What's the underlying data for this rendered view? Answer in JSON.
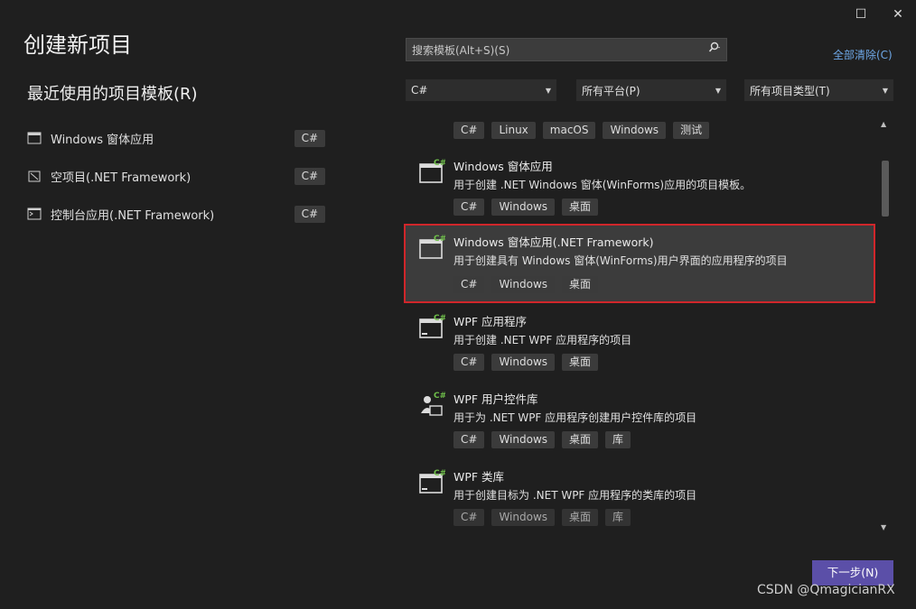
{
  "window": {
    "title": "创建新项目",
    "maximize_glyph": "☐",
    "close_glyph": "✕"
  },
  "recent": {
    "title": "最近使用的项目模板(R)",
    "items": [
      {
        "label": "Windows 窗体应用",
        "lang": "C#",
        "icon": "winforms-template-icon"
      },
      {
        "label": "空项目(.NET Framework)",
        "lang": "C#",
        "icon": "empty-project-icon"
      },
      {
        "label": "控制台应用(.NET Framework)",
        "lang": "C#",
        "icon": "console-app-icon"
      }
    ]
  },
  "search": {
    "placeholder": "搜索模板(Alt+S)(S)",
    "icon": "search-icon"
  },
  "clear_all": "全部清除(C)",
  "filters": [
    {
      "value": "C#"
    },
    {
      "value": "所有平台(P)"
    },
    {
      "value": "所有项目类型(T)"
    }
  ],
  "top_tags": [
    "C#",
    "Linux",
    "macOS",
    "Windows",
    "测试"
  ],
  "templates": [
    {
      "title": "Windows 窗体应用",
      "desc": "用于创建 .NET Windows 窗体(WinForms)应用的项目模板。",
      "tags": [
        "C#",
        "Windows",
        "桌面"
      ],
      "selected": false
    },
    {
      "title": "Windows 窗体应用(.NET Framework)",
      "desc": "用于创建具有 Windows 窗体(WinForms)用户界面的应用程序的项目",
      "tags": [
        "C#",
        "Windows",
        "桌面"
      ],
      "selected": true
    },
    {
      "title": "WPF 应用程序",
      "desc": "用于创建 .NET WPF 应用程序的项目",
      "tags": [
        "C#",
        "Windows",
        "桌面"
      ],
      "selected": false
    },
    {
      "title": "WPF 用户控件库",
      "desc": "用于为 .NET WPF 应用程序创建用户控件库的项目",
      "tags": [
        "C#",
        "Windows",
        "桌面",
        "库"
      ],
      "selected": false
    },
    {
      "title": "WPF 类库",
      "desc": "用于创建目标为 .NET WPF 应用程序的类库的项目",
      "tags": [
        "C#",
        "Windows",
        "桌面",
        "库"
      ],
      "selected": false
    }
  ],
  "next_button": "下一步(N)",
  "watermark": "CSDN @QmagicianRX",
  "colors": {
    "accent": "#5b4fa8",
    "selection_border": "#d0262b",
    "link": "#6ea7e6",
    "csharp_badge": "#6fbf4a"
  }
}
